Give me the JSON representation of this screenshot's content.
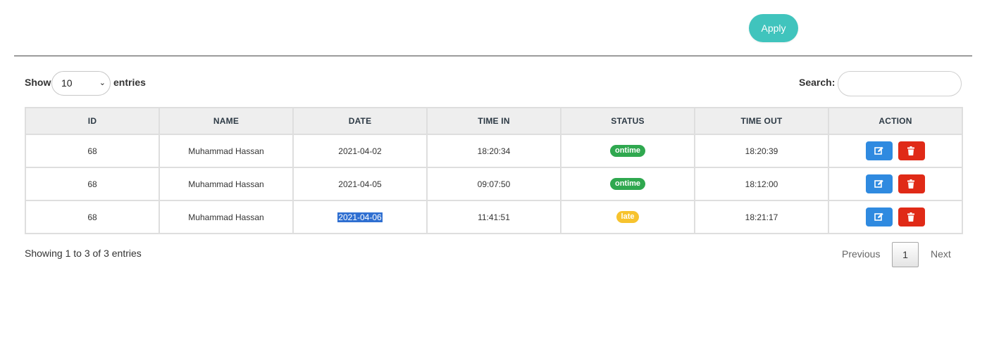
{
  "toolbar": {
    "apply_label": "Apply"
  },
  "length_menu": {
    "show_label": "Show",
    "entries_label": "entries",
    "selected": "10"
  },
  "search": {
    "label": "Search:",
    "value": ""
  },
  "table": {
    "columns": [
      "ID",
      "NAME",
      "DATE",
      "TIME IN",
      "STATUS",
      "TIME OUT",
      "ACTION"
    ],
    "rows": [
      {
        "id": "68",
        "name": "Muhammad Hassan",
        "date": "2021-04-02",
        "time_in": "18:20:34",
        "status": "ontime",
        "status_color": "#2fa84f",
        "time_out": "18:20:39"
      },
      {
        "id": "68",
        "name": "Muhammad Hassan",
        "date": "2021-04-05",
        "time_in": "09:07:50",
        "status": "ontime",
        "status_color": "#2fa84f",
        "time_out": "18:12:00"
      },
      {
        "id": "68",
        "name": "Muhammad Hassan",
        "date": "2021-04-06",
        "time_in": "11:41:51",
        "status": "late",
        "status_color": "#f7c32e",
        "time_out": "18:21:17"
      }
    ],
    "action_icons": [
      "edit-icon",
      "trash-icon"
    ]
  },
  "footer": {
    "info": "Showing 1 to 3 of 3 entries",
    "previous": "Previous",
    "current_page": "1",
    "next": "Next"
  },
  "colors": {
    "accent": "#40c4bd",
    "edit": "#2f8ae0",
    "delete": "#e02a17"
  }
}
